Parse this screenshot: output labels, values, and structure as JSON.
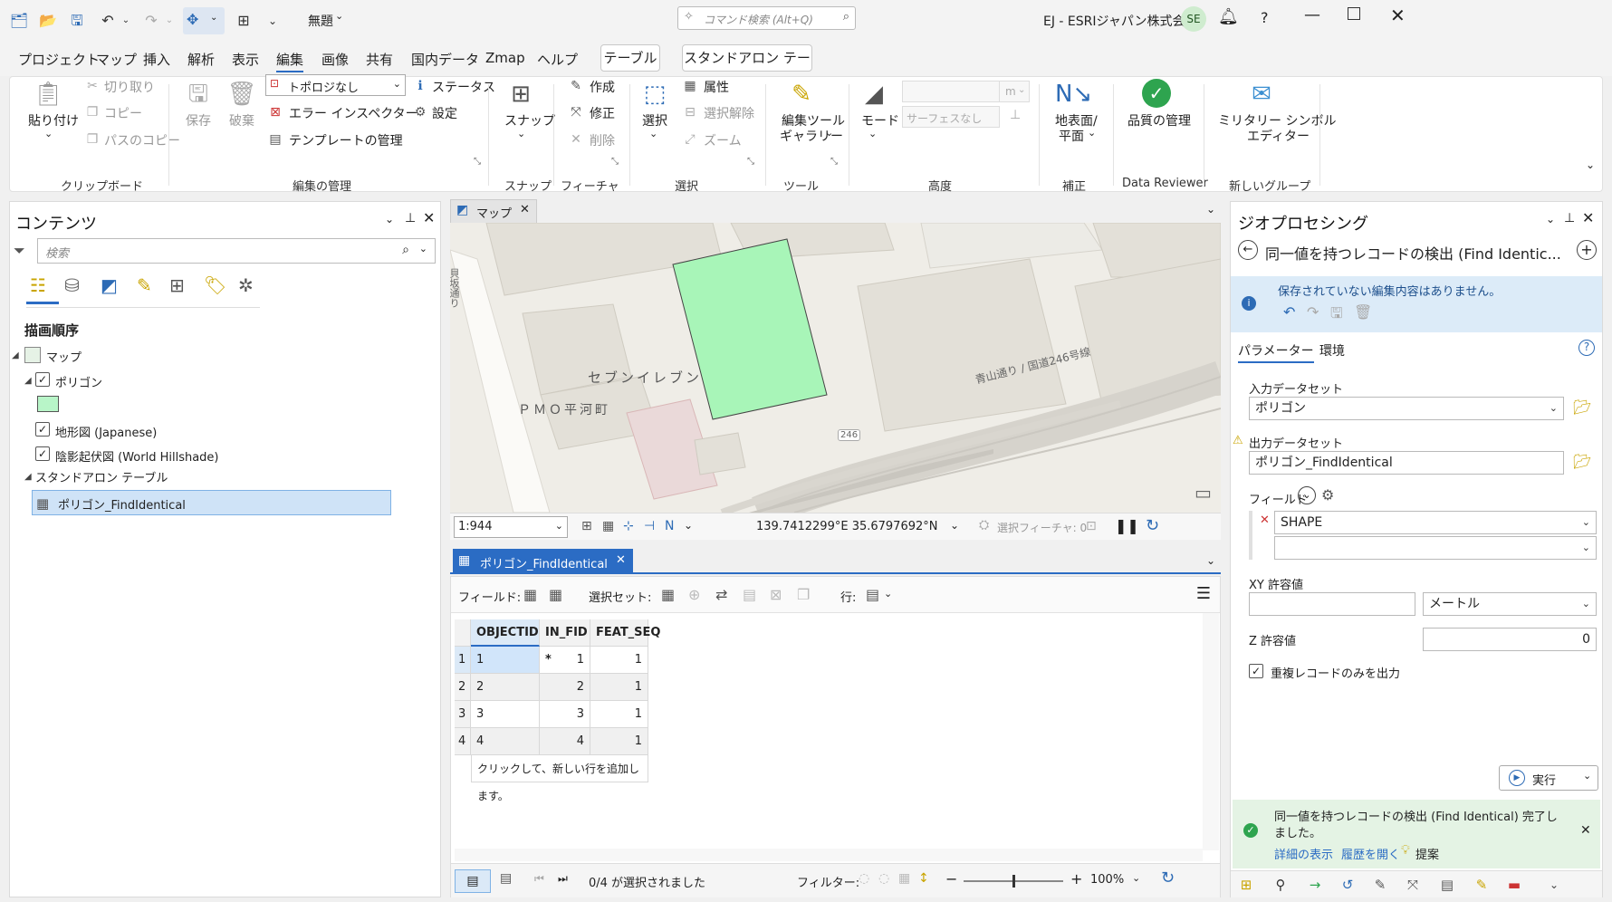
{
  "titlebar": {
    "project_name": "無題",
    "search_placeholder": "コマンド検索 (Alt+Q)",
    "org": "EJ - ESRIジャパン株式会社",
    "user_initials": "SE",
    "help": "?"
  },
  "menu": {
    "items": [
      "プロジェクト",
      "マップ",
      "挿入",
      "解析",
      "表示",
      "編集",
      "画像",
      "共有",
      "国内データ",
      "Zmap",
      "ヘルプ"
    ],
    "context_tabs": [
      "テーブル",
      "スタンドアロン テーブル"
    ]
  },
  "ribbon": {
    "paste": "貼り付け",
    "cut": "切り取り",
    "copy": "コピー",
    "copy_path": "パスのコピー",
    "group_clipboard": "クリップボード",
    "save": "保存",
    "discard": "破棄",
    "topology": "トポロジなし",
    "status": "ステータス",
    "error_inspector": "エラー インスペクター",
    "settings": "設定",
    "template_manage": "テンプレートの管理",
    "group_edit_manage": "編集の管理",
    "snap": "スナップ",
    "group_snap": "スナップ",
    "create": "作成",
    "modify": "修正",
    "delete": "削除",
    "group_features": "フィーチャ",
    "select": "選択",
    "attributes": "属性",
    "clear_selection": "選択解除",
    "zoom": "ズーム",
    "group_select": "選択",
    "edit_tool_gallery_1": "編集ツール",
    "edit_tool_gallery_2": "ギャラリー",
    "group_tools": "ツール",
    "mode": "モード",
    "elev_unit": "m",
    "surface_none": "サーフェスなし",
    "group_elevation": "高度",
    "ground_1": "地表面/",
    "ground_2": "平面",
    "group_correction": "補正",
    "quality": "品質の管理",
    "group_reviewer": "Data Reviewer",
    "military_1": "ミリタリー シンボル",
    "military_2": "エディター",
    "group_new": "新しいグループ"
  },
  "contents": {
    "title": "コンテンツ",
    "search_placeholder": "検索",
    "draw_order": "描画順序",
    "map_label": "マップ",
    "polygon_label": "ポリゴン",
    "topo_label": "地形図 (Japanese)",
    "hillshade_label": "陰影起伏図 (World Hillshade)",
    "standalone_label": "スタンドアロン テーブル",
    "table_item": "ポリゴン_FindIdentical",
    "polygon_color": "#b8f5c8"
  },
  "map": {
    "tab_label": "マップ",
    "label_seven": "セブンイレブン",
    "label_pmo": "ＰＭＯ平河町",
    "label_road": "青山通り / 国道246号線",
    "label_route": "246",
    "label_street": "貝坂通り",
    "scale": "1:944",
    "coords": "139.7412299°E 35.6797692°N",
    "selected_features": "選択フィーチャ: 0",
    "feature_fill": "#a8f5b8"
  },
  "table": {
    "tab_label": "ポリゴン_FindIdentical",
    "field_label": "フィールド:",
    "selection_label": "選択セット:",
    "row_label": "行:",
    "columns": [
      "OBJECTID *",
      "IN_FID *",
      "FEAT_SEQ"
    ],
    "rows": [
      {
        "num": "1",
        "objectid": "1",
        "in_fid": "1",
        "feat_seq": "1"
      },
      {
        "num": "2",
        "objectid": "2",
        "in_fid": "2",
        "feat_seq": "1"
      },
      {
        "num": "3",
        "objectid": "3",
        "in_fid": "3",
        "feat_seq": "1"
      },
      {
        "num": "4",
        "objectid": "4",
        "in_fid": "4",
        "feat_seq": "1"
      }
    ],
    "add_row_hint": "クリックして、新しい行を追加します。",
    "selected_status": "0/4 が選択されました",
    "filter_label": "フィルター:",
    "zoom": "100%"
  },
  "geoprocessing": {
    "title": "ジオプロセシング",
    "tool_title": "同一値を持つレコードの検出 (Find Identic...",
    "info_msg": "保存されていない編集内容はありません。",
    "tab_params": "パラメーター",
    "tab_env": "環境",
    "input_label": "入力データセット",
    "input_value": "ポリゴン",
    "output_label": "出力データセット",
    "output_value": "ポリゴン_FindIdentical",
    "field_label": "フィールド",
    "field_value": "SHAPE",
    "xy_tol_label": "XY 許容値",
    "xy_unit": "メートル",
    "z_tol_label": "Z 許容値",
    "z_value": "0",
    "only_dup_label": "重複レコードのみを出力",
    "run_label": "実行",
    "done_msg_1": "同一値を持つレコードの検出 (Find Identical) 完了し",
    "done_msg_2": "ました。",
    "link_details": "詳細の表示",
    "link_history": "履歴を開く",
    "link_suggest": "提案"
  }
}
